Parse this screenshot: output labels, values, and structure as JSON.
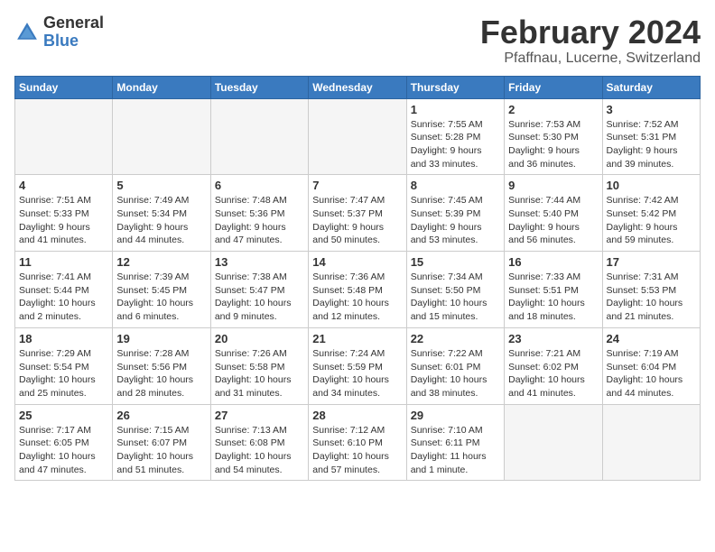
{
  "header": {
    "logo_line1": "General",
    "logo_line2": "Blue",
    "title": "February 2024",
    "subtitle": "Pfaffnau, Lucerne, Switzerland"
  },
  "calendar": {
    "days_of_week": [
      "Sunday",
      "Monday",
      "Tuesday",
      "Wednesday",
      "Thursday",
      "Friday",
      "Saturday"
    ],
    "weeks": [
      [
        {
          "day": "",
          "detail": ""
        },
        {
          "day": "",
          "detail": ""
        },
        {
          "day": "",
          "detail": ""
        },
        {
          "day": "",
          "detail": ""
        },
        {
          "day": "1",
          "detail": "Sunrise: 7:55 AM\nSunset: 5:28 PM\nDaylight: 9 hours\nand 33 minutes."
        },
        {
          "day": "2",
          "detail": "Sunrise: 7:53 AM\nSunset: 5:30 PM\nDaylight: 9 hours\nand 36 minutes."
        },
        {
          "day": "3",
          "detail": "Sunrise: 7:52 AM\nSunset: 5:31 PM\nDaylight: 9 hours\nand 39 minutes."
        }
      ],
      [
        {
          "day": "4",
          "detail": "Sunrise: 7:51 AM\nSunset: 5:33 PM\nDaylight: 9 hours\nand 41 minutes."
        },
        {
          "day": "5",
          "detail": "Sunrise: 7:49 AM\nSunset: 5:34 PM\nDaylight: 9 hours\nand 44 minutes."
        },
        {
          "day": "6",
          "detail": "Sunrise: 7:48 AM\nSunset: 5:36 PM\nDaylight: 9 hours\nand 47 minutes."
        },
        {
          "day": "7",
          "detail": "Sunrise: 7:47 AM\nSunset: 5:37 PM\nDaylight: 9 hours\nand 50 minutes."
        },
        {
          "day": "8",
          "detail": "Sunrise: 7:45 AM\nSunset: 5:39 PM\nDaylight: 9 hours\nand 53 minutes."
        },
        {
          "day": "9",
          "detail": "Sunrise: 7:44 AM\nSunset: 5:40 PM\nDaylight: 9 hours\nand 56 minutes."
        },
        {
          "day": "10",
          "detail": "Sunrise: 7:42 AM\nSunset: 5:42 PM\nDaylight: 9 hours\nand 59 minutes."
        }
      ],
      [
        {
          "day": "11",
          "detail": "Sunrise: 7:41 AM\nSunset: 5:44 PM\nDaylight: 10 hours\nand 2 minutes."
        },
        {
          "day": "12",
          "detail": "Sunrise: 7:39 AM\nSunset: 5:45 PM\nDaylight: 10 hours\nand 6 minutes."
        },
        {
          "day": "13",
          "detail": "Sunrise: 7:38 AM\nSunset: 5:47 PM\nDaylight: 10 hours\nand 9 minutes."
        },
        {
          "day": "14",
          "detail": "Sunrise: 7:36 AM\nSunset: 5:48 PM\nDaylight: 10 hours\nand 12 minutes."
        },
        {
          "day": "15",
          "detail": "Sunrise: 7:34 AM\nSunset: 5:50 PM\nDaylight: 10 hours\nand 15 minutes."
        },
        {
          "day": "16",
          "detail": "Sunrise: 7:33 AM\nSunset: 5:51 PM\nDaylight: 10 hours\nand 18 minutes."
        },
        {
          "day": "17",
          "detail": "Sunrise: 7:31 AM\nSunset: 5:53 PM\nDaylight: 10 hours\nand 21 minutes."
        }
      ],
      [
        {
          "day": "18",
          "detail": "Sunrise: 7:29 AM\nSunset: 5:54 PM\nDaylight: 10 hours\nand 25 minutes."
        },
        {
          "day": "19",
          "detail": "Sunrise: 7:28 AM\nSunset: 5:56 PM\nDaylight: 10 hours\nand 28 minutes."
        },
        {
          "day": "20",
          "detail": "Sunrise: 7:26 AM\nSunset: 5:58 PM\nDaylight: 10 hours\nand 31 minutes."
        },
        {
          "day": "21",
          "detail": "Sunrise: 7:24 AM\nSunset: 5:59 PM\nDaylight: 10 hours\nand 34 minutes."
        },
        {
          "day": "22",
          "detail": "Sunrise: 7:22 AM\nSunset: 6:01 PM\nDaylight: 10 hours\nand 38 minutes."
        },
        {
          "day": "23",
          "detail": "Sunrise: 7:21 AM\nSunset: 6:02 PM\nDaylight: 10 hours\nand 41 minutes."
        },
        {
          "day": "24",
          "detail": "Sunrise: 7:19 AM\nSunset: 6:04 PM\nDaylight: 10 hours\nand 44 minutes."
        }
      ],
      [
        {
          "day": "25",
          "detail": "Sunrise: 7:17 AM\nSunset: 6:05 PM\nDaylight: 10 hours\nand 47 minutes."
        },
        {
          "day": "26",
          "detail": "Sunrise: 7:15 AM\nSunset: 6:07 PM\nDaylight: 10 hours\nand 51 minutes."
        },
        {
          "day": "27",
          "detail": "Sunrise: 7:13 AM\nSunset: 6:08 PM\nDaylight: 10 hours\nand 54 minutes."
        },
        {
          "day": "28",
          "detail": "Sunrise: 7:12 AM\nSunset: 6:10 PM\nDaylight: 10 hours\nand 57 minutes."
        },
        {
          "day": "29",
          "detail": "Sunrise: 7:10 AM\nSunset: 6:11 PM\nDaylight: 11 hours\nand 1 minute."
        },
        {
          "day": "",
          "detail": ""
        },
        {
          "day": "",
          "detail": ""
        }
      ]
    ]
  }
}
